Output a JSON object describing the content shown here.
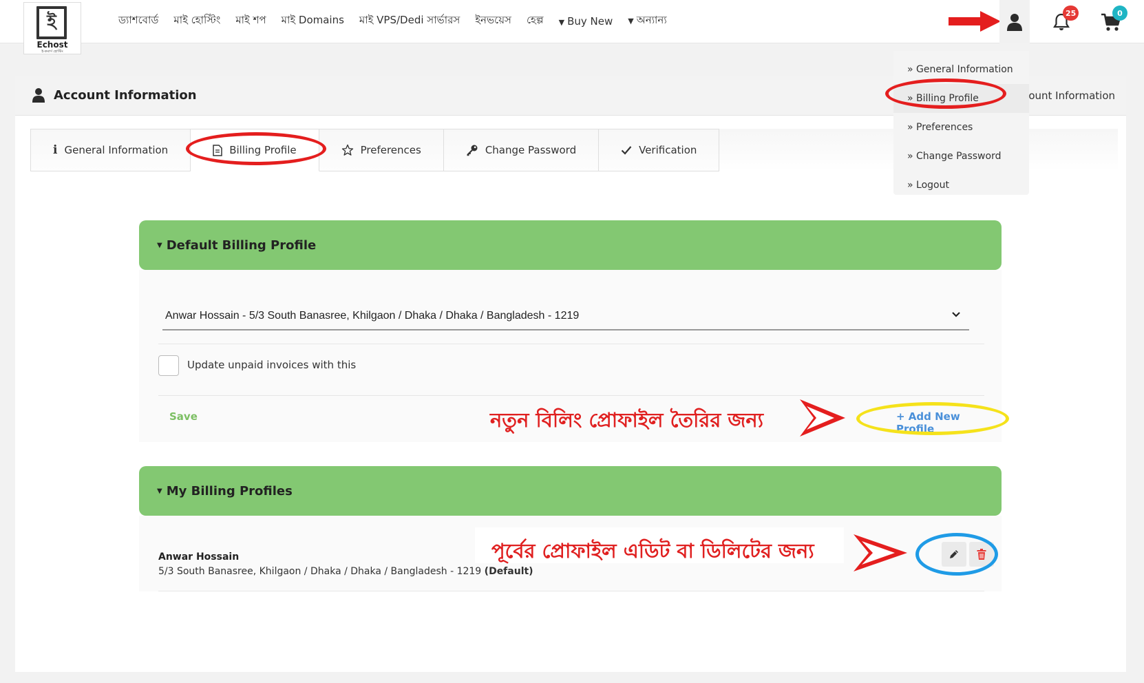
{
  "brand": {
    "name": "Echost",
    "mark": "ই",
    "tagline": "ই-কমার্স হোস্টিং"
  },
  "nav": {
    "items": [
      "ড্যাশবোর্ড",
      "মাই হোস্টিং",
      "মাই শপ",
      "মাই Domains",
      "মাই VPS/Dedi সার্ভারস",
      "ইনভয়েস",
      "হেল্প"
    ],
    "buy_new": "Buy New",
    "others": "অন্যান্য"
  },
  "header_icons": {
    "notifications_count": "25",
    "cart_count": "0"
  },
  "dropdown": {
    "items": [
      "» General Information",
      "» Billing Profile",
      "» Preferences",
      "» Change Password",
      "» Logout"
    ]
  },
  "card": {
    "title": "Account Information",
    "header_right": "ount Information",
    "tabs": [
      "General Information",
      "Billing Profile",
      "Preferences",
      "Change Password",
      "Verification"
    ]
  },
  "default_profile": {
    "heading": "Default Billing Profile",
    "selected": "Anwar Hossain - 5/3 South Banasree, Khilgaon / Dhaka / Dhaka / Bangladesh - 1219",
    "checkbox_label": "Update unpaid invoices with this",
    "save_label": "Save",
    "add_label": "+ Add New Profile"
  },
  "my_profiles": {
    "heading": "My Billing Profiles",
    "profile": {
      "name": "Anwar Hossain",
      "address": "5/3 South Banasree, Khilgaon / Dhaka / Dhaka / Bangladesh - 1219",
      "default_tag": "(Default)"
    }
  },
  "annotations": {
    "add_note": "নতুন বিলিং প্রোফাইল তৈরির জন্য",
    "edit_note": "পূর্বের প্রোফাইল এডিট বা ডিলিটের জন্য"
  },
  "colors": {
    "section_green": "#83c872",
    "annotation_red": "#e02020",
    "highlight_yellow": "#f5e21b",
    "highlight_blue": "#1f9be6"
  }
}
